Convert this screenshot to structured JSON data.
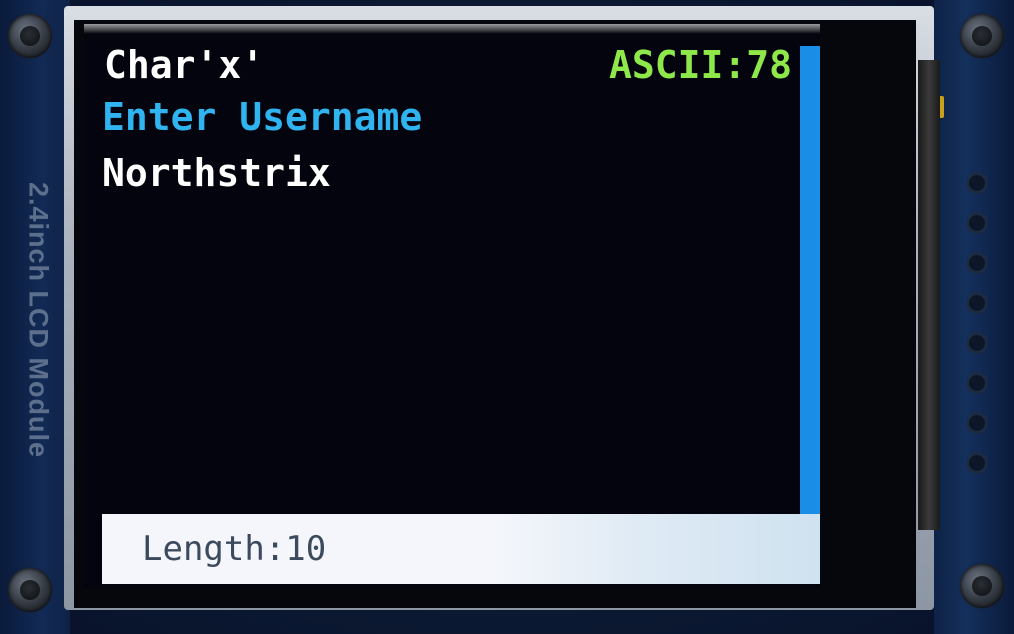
{
  "module": {
    "label": "2.4inch LCD Module"
  },
  "screen": {
    "char_label": "Char'x'",
    "ascii_label": "ASCII:78",
    "prompt": "Enter Username",
    "username_value": "Northstrix",
    "status": {
      "length_label": "Length:10"
    }
  },
  "colors": {
    "char_label": "#ffffff",
    "ascii_label": "#8fe84a",
    "prompt": "#2fb4f0",
    "username_value": "#ffffff",
    "scrollbar": "#1a8ee6",
    "status_bar": "#f4f6fb",
    "status_text": "#3c4a5e",
    "background": "#03040d"
  }
}
